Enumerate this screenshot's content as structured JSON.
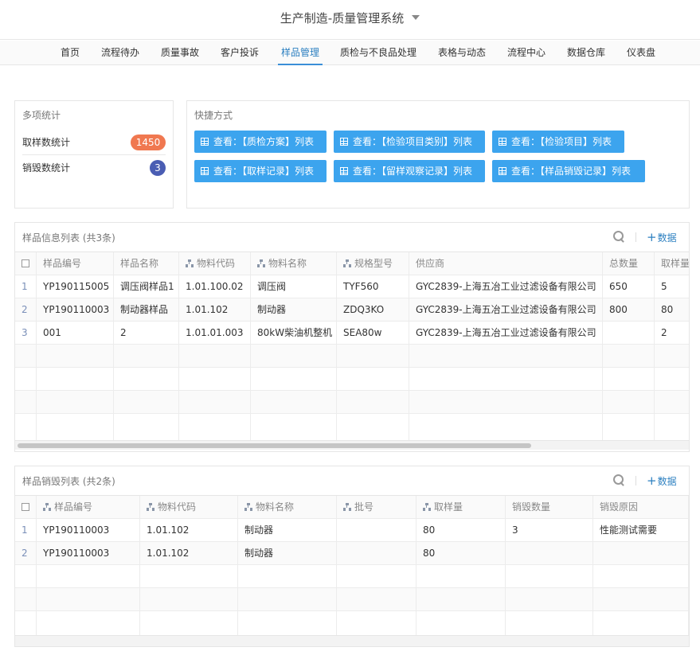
{
  "app": {
    "title": "生产制造-质量管理系统"
  },
  "nav": [
    "首页",
    "流程待办",
    "质量事故",
    "客户投诉",
    "样品管理",
    "质检与不良品处理",
    "表格与动态",
    "流程中心",
    "数据仓库",
    "仪表盘"
  ],
  "stats": {
    "title": "多项统计",
    "items": [
      {
        "label": "取样数统计",
        "value": "1450"
      },
      {
        "label": "销毁数统计",
        "value": "3"
      }
    ]
  },
  "shortcuts": {
    "title": "快捷方式",
    "buttons": [
      "查看：【质检方案】列表",
      "查看：【检验项目类别】列表",
      "查看：【检验项目】列表",
      "查看：【取样记录】列表",
      "查看：【留样观察记录】列表",
      "查看：【样品销毁记录】列表"
    ]
  },
  "sample_table": {
    "title": "样品信息列表 (共3条)",
    "add_label": "数据",
    "columns": [
      "样品编号",
      "样品名称",
      "物料代码",
      "物料名称",
      "规格型号",
      "供应商",
      "总数量",
      "取样量"
    ],
    "rows": [
      {
        "n": "1",
        "cells": [
          "YP190115005",
          "调压阀样品1",
          "1.01.100.02",
          "调压阀",
          "TYF560",
          "GYC2839-上海五冶工业过滤设备有限公司",
          "650",
          "5"
        ]
      },
      {
        "n": "2",
        "cells": [
          "YP190110003",
          "制动器样品",
          "1.01.102",
          "制动器",
          "ZDQ3KO",
          "GYC2839-上海五冶工业过滤设备有限公司",
          "800",
          "80"
        ]
      },
      {
        "n": "3",
        "cells": [
          "001",
          "2",
          "1.01.01.003",
          "80kW柴油机整机",
          "SEA80w",
          "GYC2839-上海五冶工业过滤设备有限公司",
          "",
          "2"
        ]
      }
    ]
  },
  "destroy_table": {
    "title": "样品销毁列表 (共2条)",
    "add_label": "数据",
    "columns": [
      "样品编号",
      "物料代码",
      "物料名称",
      "批号",
      "取样量",
      "销毁数量",
      "销毁原因"
    ],
    "rows": [
      {
        "n": "1",
        "cells": [
          "YP190110003",
          "1.01.102",
          "制动器",
          "",
          "80",
          "3",
          "性能测试需要"
        ]
      },
      {
        "n": "2",
        "cells": [
          "YP190110003",
          "1.01.102",
          "制动器",
          "",
          "80",
          "",
          ""
        ]
      }
    ]
  }
}
